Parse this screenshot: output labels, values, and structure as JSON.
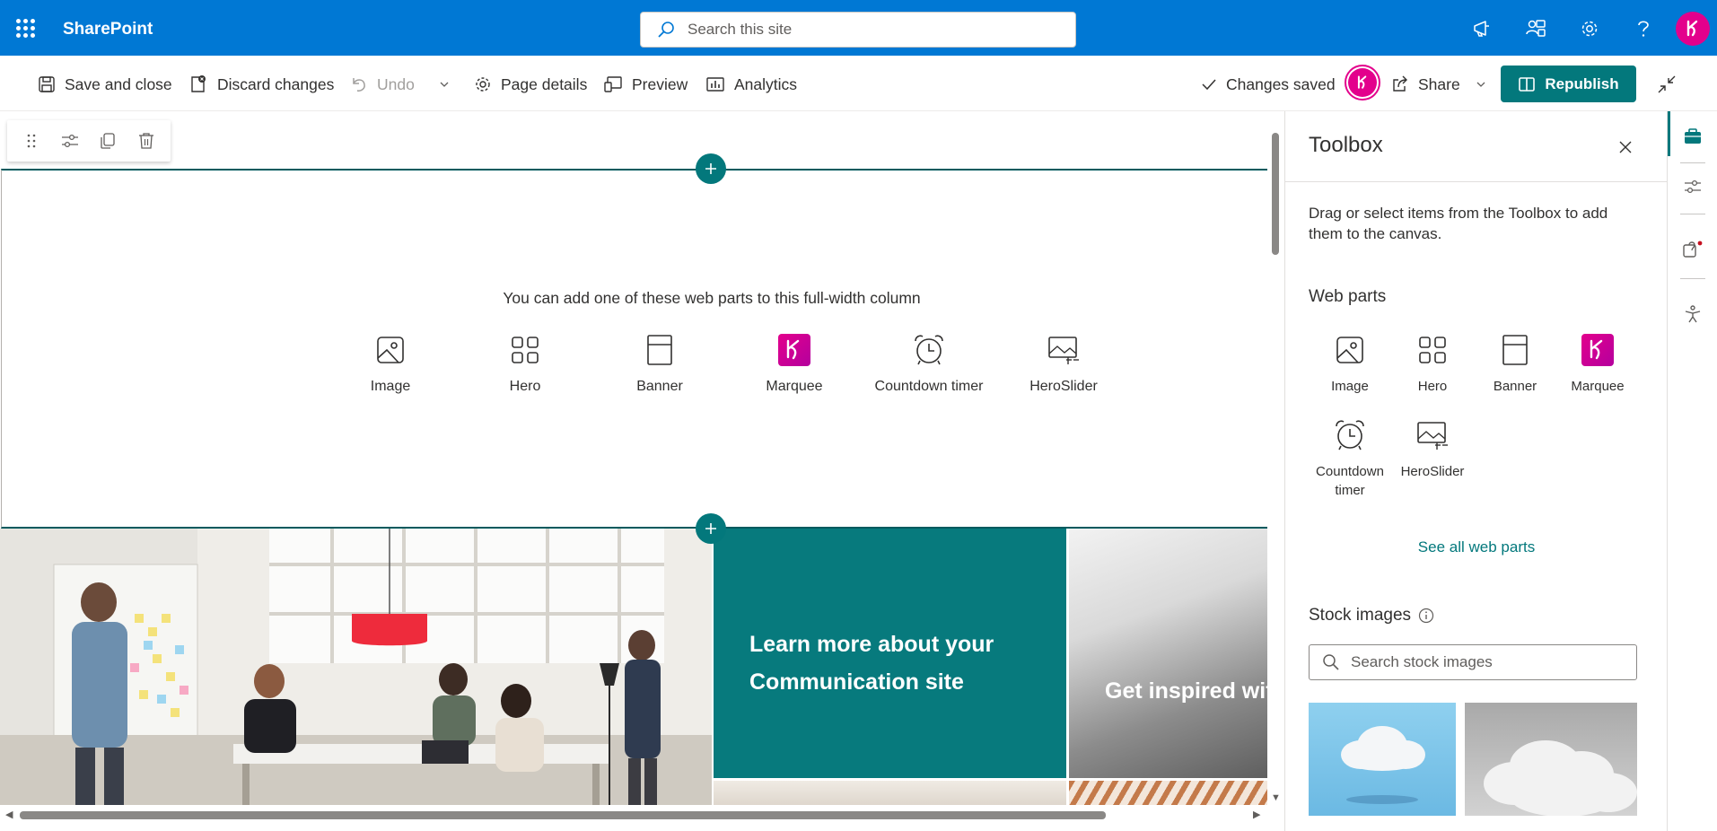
{
  "suite": {
    "app_name": "SharePoint",
    "search_placeholder": "Search this site",
    "icons": [
      "megaphone-icon",
      "people-icon",
      "gear-icon",
      "help-icon"
    ],
    "brand_color": "#0078d4"
  },
  "commands": {
    "save_close": "Save and close",
    "discard": "Discard changes",
    "undo": "Undo",
    "page_details": "Page details",
    "preview": "Preview",
    "analytics": "Analytics",
    "status": "Changes saved",
    "share": "Share",
    "republish": "Republish",
    "accent": "#03787c"
  },
  "section": {
    "prompt": "You can add one of these web parts to this full-width column",
    "webparts": [
      {
        "label": "Image",
        "icon": "image-icon"
      },
      {
        "label": "Hero",
        "icon": "hero-icon"
      },
      {
        "label": "Banner",
        "icon": "banner-icon"
      },
      {
        "label": "Marquee",
        "icon": "marquee-icon"
      },
      {
        "label": "Countdown timer",
        "icon": "alarm-clock-icon"
      },
      {
        "label": "HeroSlider",
        "icon": "slider-icon"
      }
    ]
  },
  "hero": {
    "tile2_text": "Learn more about your Communication site",
    "tile3_text": "Get inspired with SharePoint look"
  },
  "toolbox": {
    "title": "Toolbox",
    "description": "Drag or select items from the Toolbox to add them to the canvas.",
    "webparts_heading": "Web parts",
    "items": [
      {
        "label": "Image",
        "icon": "image-icon"
      },
      {
        "label": "Hero",
        "icon": "hero-icon"
      },
      {
        "label": "Banner",
        "icon": "banner-icon"
      },
      {
        "label": "Marquee",
        "icon": "marquee-icon"
      },
      {
        "label": "Countdown timer",
        "icon": "alarm-clock-icon"
      },
      {
        "label": "HeroSlider",
        "icon": "slider-icon"
      }
    ],
    "see_all": "See all web parts",
    "stock_heading": "Stock images",
    "stock_search_placeholder": "Search stock images"
  },
  "rail": {
    "icons": [
      "toolbox-icon",
      "properties-icon",
      "design-ideas-icon",
      "accessibility-icon"
    ]
  }
}
